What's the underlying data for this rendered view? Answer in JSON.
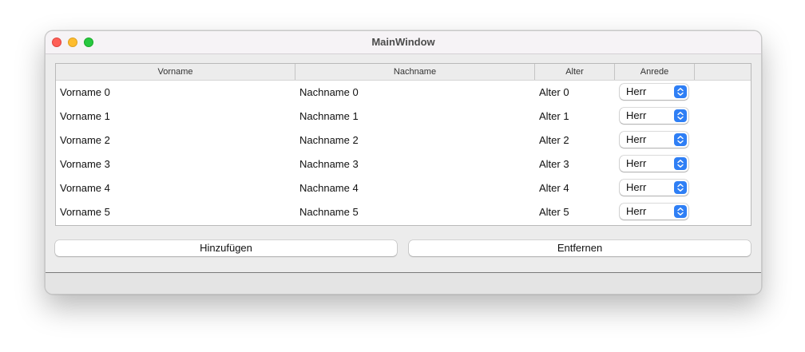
{
  "window": {
    "title": "MainWindow"
  },
  "table": {
    "columns": [
      "Vorname",
      "Nachname",
      "Alter",
      "Anrede"
    ],
    "rows": [
      {
        "vorname": "Vorname 0",
        "nachname": "Nachname 0",
        "alter": "Alter 0",
        "anrede": "Herr"
      },
      {
        "vorname": "Vorname 1",
        "nachname": "Nachname 1",
        "alter": "Alter 1",
        "anrede": "Herr"
      },
      {
        "vorname": "Vorname 2",
        "nachname": "Nachname 2",
        "alter": "Alter 2",
        "anrede": "Herr"
      },
      {
        "vorname": "Vorname 3",
        "nachname": "Nachname 3",
        "alter": "Alter 3",
        "anrede": "Herr"
      },
      {
        "vorname": "Vorname 4",
        "nachname": "Nachname 4",
        "alter": "Alter 4",
        "anrede": "Herr"
      },
      {
        "vorname": "Vorname 5",
        "nachname": "Nachname 5",
        "alter": "Alter 5",
        "anrede": "Herr"
      }
    ]
  },
  "buttons": {
    "add_label": "Hinzufügen",
    "remove_label": "Entfernen"
  },
  "colors": {
    "close": "#fe5f57",
    "minimize": "#febc2e",
    "maximize": "#28c840",
    "accent": "#2f7ff5",
    "window_bg": "#ececec"
  },
  "icons": {
    "popup": "up-down-chevron-icon"
  }
}
